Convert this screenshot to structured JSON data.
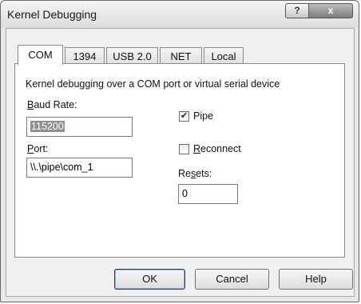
{
  "window": {
    "title": "Kernel Debugging",
    "help_glyph": "?",
    "close_glyph": "x"
  },
  "tabs": [
    {
      "label": "COM",
      "active": true
    },
    {
      "label": "1394",
      "active": false
    },
    {
      "label": "USB 2.0",
      "active": false
    },
    {
      "label": "NET",
      "active": false
    },
    {
      "label": "Local",
      "active": false
    }
  ],
  "com": {
    "description": "Kernel debugging over a COM port or virtual serial device",
    "baud_rate": {
      "label_first": "B",
      "label_rest": "aud Rate:",
      "value": "115200"
    },
    "port": {
      "label_first": "P",
      "label_rest": "ort:",
      "value": "\\\\.\\pipe\\com_1"
    },
    "pipe": {
      "label": "Pipe",
      "checked": true,
      "check_glyph": "✔"
    },
    "reconnect": {
      "label_first": "R",
      "label_rest": "econnect",
      "checked": false
    },
    "resets": {
      "label_pre": "Re",
      "label_ul": "s",
      "label_post": "ets:",
      "value": "0"
    }
  },
  "buttons": {
    "ok": "OK",
    "cancel": "Cancel",
    "help": "Help"
  }
}
